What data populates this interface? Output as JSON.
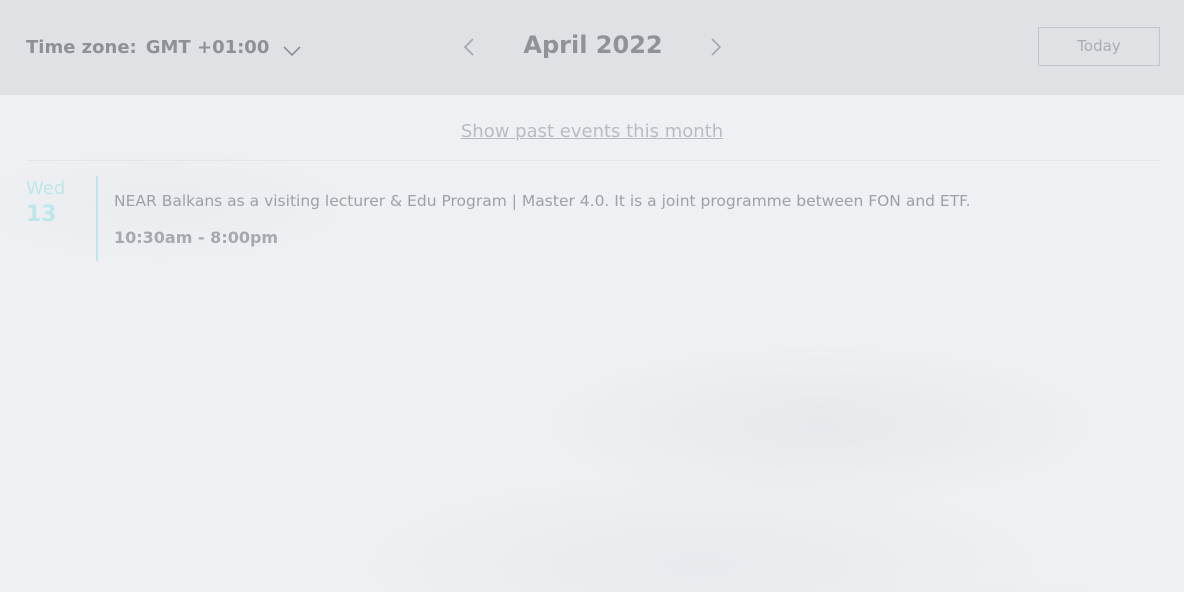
{
  "header": {
    "timezone_label": "Time zone:",
    "timezone_value": "GMT +01:00",
    "timezone_dropdown_icon": "chevron-down-icon",
    "prev_icon": "chevron-left-icon",
    "next_icon": "chevron-right-icon",
    "month_title": "April 2022",
    "today_label": "Today"
  },
  "main": {
    "show_past_label": "Show past events this month",
    "events": [
      {
        "day_of_week": "Wed",
        "day_number": "13",
        "title": "NEAR Balkans as a visiting lecturer & Edu Program | Master 4.0. It is a joint programme between FON and ETF.",
        "time": "10:30am - 8:00pm"
      }
    ]
  },
  "colors": {
    "header_bg": "#dfe2e5",
    "page_bg": "#eef0f3",
    "accent": "#bfe6ea",
    "text_muted": "#8d9196"
  }
}
